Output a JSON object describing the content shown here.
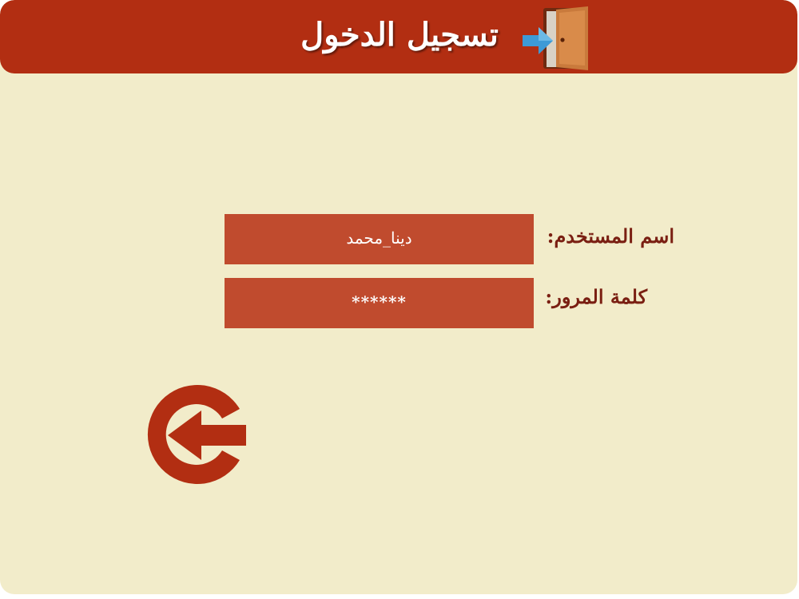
{
  "header": {
    "title": "تسجيل الدخول",
    "icon": "door-enter-icon"
  },
  "form": {
    "username_label": "اسم المستخدم:",
    "username_value": "دينا_محمد",
    "password_label": "كلمة المرور:",
    "password_value": "******"
  },
  "actions": {
    "back_icon": "back-arrow-icon"
  },
  "colors": {
    "header_bg": "#b22e12",
    "page_bg": "#f2ecca",
    "field_bg": "#c04b2e",
    "label_text": "#7a1f12",
    "accent_arrow": "#3d9ad6"
  }
}
